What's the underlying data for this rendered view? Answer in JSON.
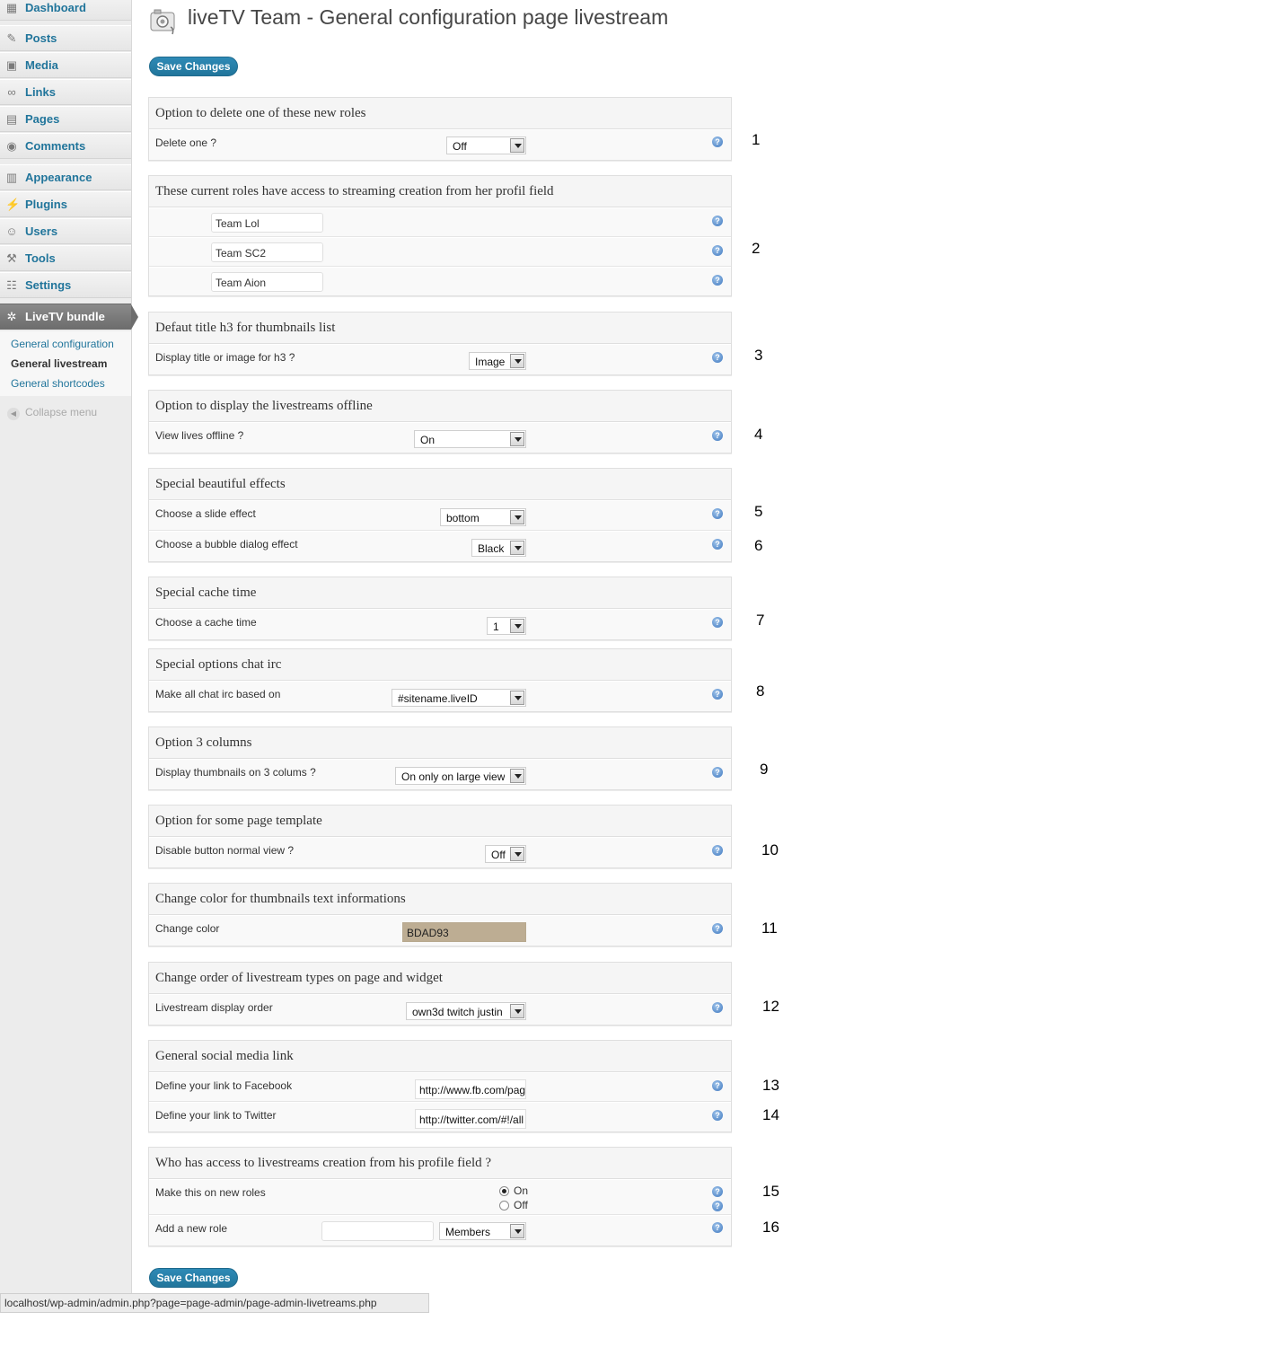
{
  "sidebar": {
    "items": [
      {
        "label": "Dashboard",
        "icon": "dashboard-icon"
      },
      {
        "label": "Posts",
        "icon": "pin-icon"
      },
      {
        "label": "Media",
        "icon": "media-icon"
      },
      {
        "label": "Links",
        "icon": "link-icon"
      },
      {
        "label": "Pages",
        "icon": "pages-icon"
      },
      {
        "label": "Comments",
        "icon": "comment-icon"
      },
      {
        "label": "Appearance",
        "icon": "appearance-icon"
      },
      {
        "label": "Plugins",
        "icon": "plug-icon"
      },
      {
        "label": "Users",
        "icon": "users-icon"
      },
      {
        "label": "Tools",
        "icon": "tools-icon"
      },
      {
        "label": "Settings",
        "icon": "settings-icon"
      },
      {
        "label": "LiveTV bundle",
        "icon": "gear-icon"
      }
    ],
    "submenu": [
      "General configuration",
      "General livestream",
      "General shortcodes"
    ],
    "collapse": "Collapse menu"
  },
  "page": {
    "title": "liveTV Team - General configuration page livestream",
    "save_label": "Save Changes"
  },
  "sections": [
    {
      "title": "Option to delete one of these new roles",
      "label": "Delete one ?",
      "value": "Off",
      "annotation": "1"
    },
    {
      "title": "These current roles have access to streaming creation from her profil field",
      "roles": [
        "Team Lol",
        "Team SC2",
        "Team Aion"
      ],
      "annotation": "2"
    },
    {
      "title": "Defaut title h3 for thumbnails list",
      "label": "Display title or image for h3 ?",
      "value": "Image",
      "annotation": "3"
    },
    {
      "title": "Option to display the livestreams offline",
      "label": "View lives offline ?",
      "value": "On",
      "annotation": "4"
    },
    {
      "title": "Special beautiful effects",
      "label": "Choose a slide effect",
      "value": "bottom",
      "annotation": "5",
      "label2": "Choose a bubble dialog effect",
      "value2": "Black",
      "annotation2": "6"
    },
    {
      "title": "Special cache time",
      "label": "Choose a cache time",
      "value": "1",
      "annotation": "7"
    },
    {
      "title": "Special options chat irc",
      "label": "Make all chat irc based on",
      "value": "#sitename.liveID",
      "annotation": "8"
    },
    {
      "title": "Option 3 columns",
      "label": "Display thumbnails on 3 colums ?",
      "value": "On only on large view",
      "annotation": "9"
    },
    {
      "title": "Option for some page template",
      "label": "Disable button normal view ?",
      "value": "Off",
      "annotation": "10"
    },
    {
      "title": "Change color for thumbnails text informations",
      "label": "Change color",
      "value": "BDAD93",
      "color": "#bdad93",
      "annotation": "11"
    },
    {
      "title": "Change order of livestream types on page and widget",
      "label": "Livestream display order",
      "value": "own3d twitch justin",
      "annotation": "12"
    },
    {
      "title": "General social media link",
      "label": "Define your link to Facebook",
      "value": "http://www.fb.com/pag",
      "annotation": "13",
      "label2": "Define your link to Twitter",
      "value2": "http://twitter.com/#!/all",
      "annotation2": "14"
    },
    {
      "title": "Who has access to livestreams creation from his profile field ?",
      "label": "Make this on new roles",
      "radio_on": "On",
      "radio_off": "Off",
      "annotation": "15",
      "label2": "Add a new role",
      "input_value": "",
      "value2": "Members",
      "annotation2": "16"
    }
  ],
  "status_bar": "localhost/wp-admin/admin.php?page=page-admin/page-admin-livetreams.php",
  "colors": {
    "accent": "#21759b",
    "button": "#21759b",
    "swatch": "#bdad93"
  }
}
